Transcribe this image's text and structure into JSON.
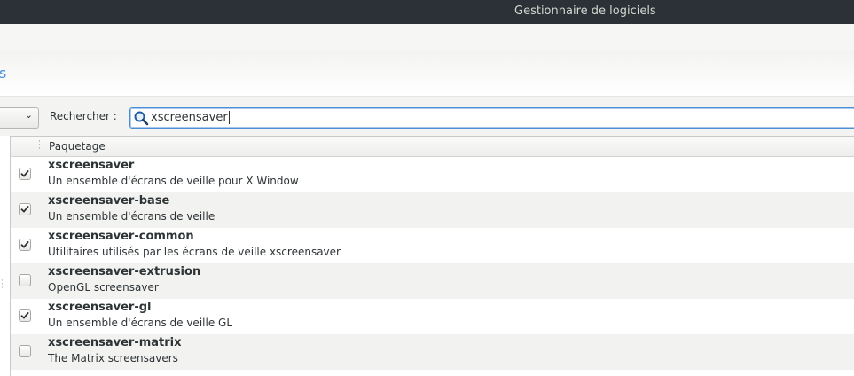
{
  "window": {
    "title": "Gestionnaire de logiciels"
  },
  "subbar": {
    "link_text": "s"
  },
  "filter": {
    "combo_arrow": "⌄",
    "search_label": "Rechercher :",
    "search_value": "xscreensaver"
  },
  "list": {
    "column_header": "Paquetage",
    "packages": [
      {
        "name": "xscreensaver",
        "description": "Un ensemble d'écrans de veille pour X Window",
        "installed": true
      },
      {
        "name": "xscreensaver-base",
        "description": "Un ensemble d'écrans de veille",
        "installed": true
      },
      {
        "name": "xscreensaver-common",
        "description": "Utilitaires utilisés par les écrans de veille xscreensaver",
        "installed": true
      },
      {
        "name": "xscreensaver-extrusion",
        "description": "OpenGL screensaver",
        "installed": false
      },
      {
        "name": "xscreensaver-gl",
        "description": "Un ensemble d'écrans de veille GL",
        "installed": true
      },
      {
        "name": "xscreensaver-matrix",
        "description": "The Matrix screensavers",
        "installed": false
      }
    ]
  },
  "colors": {
    "titlebar": "#2c3138",
    "accent": "#4a90d9",
    "row_alt": "#f2f2f1"
  },
  "icons": {
    "search": "search-icon",
    "check": "checkmark-icon"
  }
}
